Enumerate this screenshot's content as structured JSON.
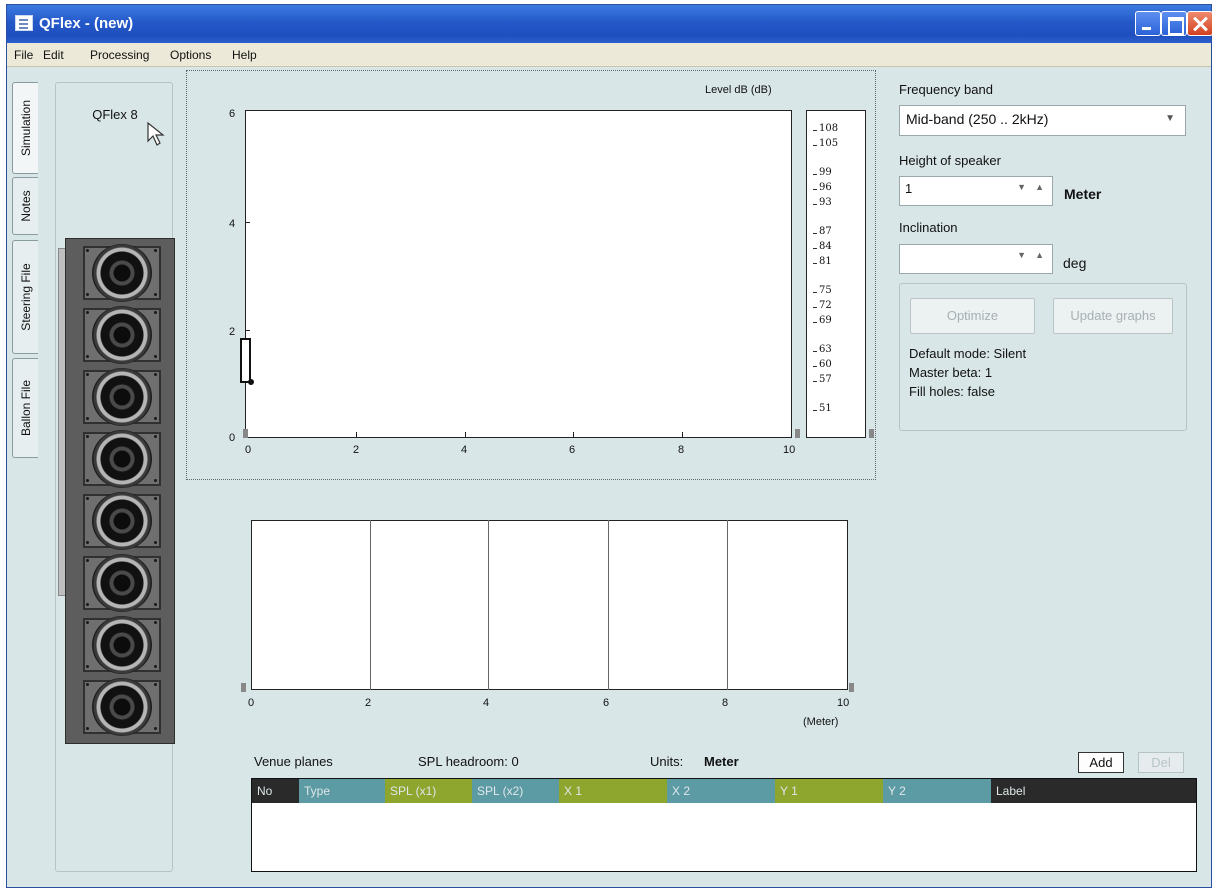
{
  "window": {
    "title": "QFlex - (new)"
  },
  "menu": [
    "File",
    "Edit",
    "Processing",
    "Options",
    "Help"
  ],
  "tabs": [
    "Simulation",
    "Notes",
    "Steering File",
    "Ballon File"
  ],
  "speaker": {
    "name": "QFlex 8",
    "driver_count": 8
  },
  "main_plot": {
    "colorbar_title": "Level dB  (dB)",
    "y_ticks": [
      "6",
      "4",
      "2",
      "0"
    ],
    "x_ticks": [
      "0",
      "2",
      "4",
      "6",
      "8",
      "10"
    ],
    "colorbar_ticks": [
      "108",
      "105",
      "99",
      "96",
      "93",
      "87",
      "84",
      "81",
      "75",
      "72",
      "69",
      "63",
      "60",
      "57",
      "51"
    ]
  },
  "lower_plot": {
    "x_ticks": [
      "0",
      "2",
      "4",
      "6",
      "8",
      "10"
    ],
    "unit_label": "(Meter)"
  },
  "controls": {
    "frequency_band_label": "Frequency band",
    "frequency_band_value": "Mid-band (250 .. 2kHz)",
    "height_label": "Height of speaker",
    "height_value": "1",
    "height_unit": "Meter",
    "inclination_label": "Inclination",
    "inclination_value": "",
    "inclination_unit": "deg",
    "optimize_label": "Optimize",
    "update_label": "Update graphs",
    "default_mode": "Default mode: Silent",
    "master_beta": "Master beta: 1",
    "fill_holes": "Fill holes: false"
  },
  "venue": {
    "title": "Venue planes",
    "spl_headroom": "SPL headroom: 0",
    "units_label": "Units:",
    "units_value": "Meter",
    "add_label": "Add",
    "del_label": "Del",
    "columns": [
      "No",
      "Type",
      "SPL (x1)",
      "SPL (x2)",
      "X 1",
      "X 2",
      "Y 1",
      "Y 2",
      "Label"
    ],
    "column_colors": [
      "#2a2a2a",
      "#5c9aa4",
      "#8ea52e",
      "#5c9aa4",
      "#8ea52e",
      "#5c9aa4",
      "#8ea52e",
      "#5c9aa4",
      "#2a2a2a"
    ]
  },
  "icons": [
    "app-icon",
    "minimize-icon",
    "maximize-icon",
    "close-icon",
    "mouse-cursor-icon",
    "chevron-down-icon",
    "spin-down-icon",
    "spin-up-icon"
  ]
}
